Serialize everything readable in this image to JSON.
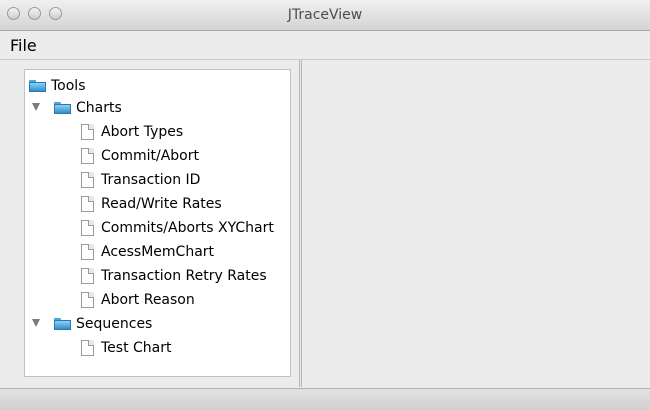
{
  "window": {
    "title": "JTraceView"
  },
  "menu": {
    "file": "File"
  },
  "tree": {
    "root": {
      "label": "Tools",
      "icon": "folder-icon"
    },
    "charts": {
      "label": "Charts",
      "icon": "folder-icon",
      "expanded": true,
      "items": [
        "Abort Types",
        "Commit/Abort",
        "Transaction ID",
        "Read/Write Rates",
        "Commits/Aborts XYChart",
        "AcessMemChart",
        "Transaction Retry Rates",
        "Abort Reason"
      ]
    },
    "sequences": {
      "label": "Sequences",
      "icon": "folder-icon",
      "expanded": true,
      "items": [
        "Test Chart"
      ]
    }
  },
  "colors": {
    "folder": "#4aa7d9",
    "window_bg": "#ececec"
  }
}
